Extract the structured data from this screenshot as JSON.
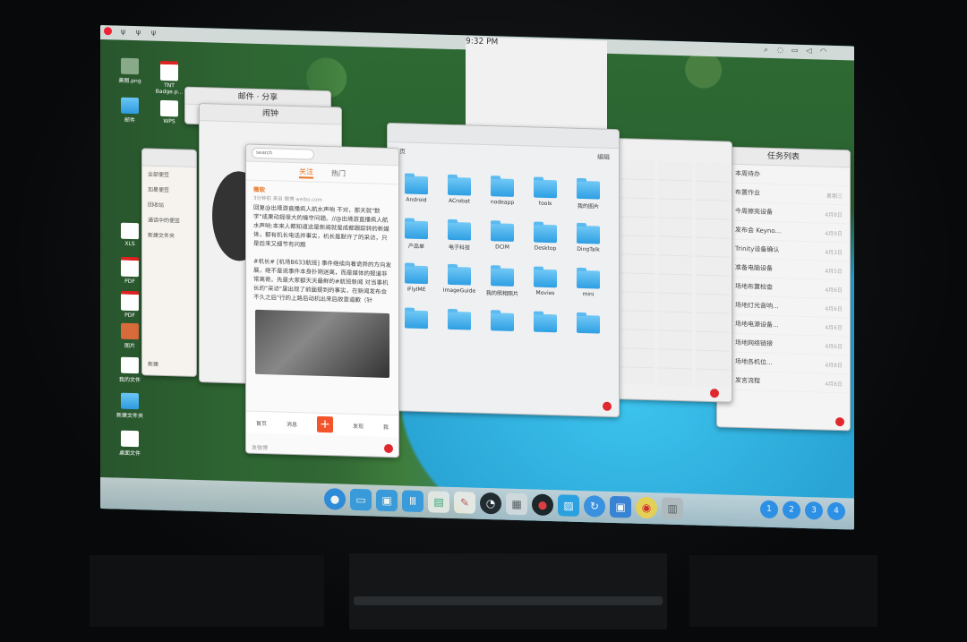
{
  "menubar": {
    "clock": "9:32 PM"
  },
  "clock_window": {
    "title": "闹钟"
  },
  "clock_back_title": {
    "title": "邮件 · 分享"
  },
  "weibo": {
    "search_placeholder": "search",
    "tab_follow": "关注",
    "tab_hot": "热门",
    "post1_user": "微软",
    "post1_meta": "3分钟前 来自 微博 weibo.com",
    "post1_text": "回复@出境游直播疯人航水声响 不对，那天就\"数字\"成果动摇很大的操守问题。//@出境游直播疯人航水声响:本来人都知道这是新闻就是成都跟踪转的新媒体，都有机长电话并事实，机长是默许了的采访，只是后来又细节有问题",
    "post2_text": "#机长# [机场B633航班] 事件继续向着诡异的方向发展，继不是说事件本身扑朔迷离，而是媒体的报道非常离奇。先是大家都天天最鲜的#航班新闻 对当事机长的\"采访\"里出现了前面提到的事实，在新闻发布会不久之后\"行的上路后动机出来后故意道歉（针",
    "nav_home": "首页",
    "nav_msg": "消息",
    "nav_discover": "发现",
    "nav_me": "我",
    "compose": "发微博"
  },
  "files": {
    "path": "主页",
    "right_label": "编辑",
    "items": [
      {
        "name": "Android"
      },
      {
        "name": "ACrobat"
      },
      {
        "name": "nodeapp"
      },
      {
        "name": "tools"
      },
      {
        "name": "我的图片"
      },
      {
        "name": "产品单"
      },
      {
        "name": "电子科技"
      },
      {
        "name": "DCIM"
      },
      {
        "name": "Desktop"
      },
      {
        "name": "DingTalk"
      },
      {
        "name": "iFlyIME"
      },
      {
        "name": "ImageGuide"
      },
      {
        "name": "我的照相照片"
      },
      {
        "name": "Movies"
      },
      {
        "name": "mini"
      },
      {
        "name": ""
      },
      {
        "name": ""
      },
      {
        "name": ""
      },
      {
        "name": ""
      },
      {
        "name": ""
      }
    ]
  },
  "tasklist": {
    "title": "任务列表",
    "items": [
      {
        "label": "本周待办",
        "time": ""
      },
      {
        "label": "布置作业",
        "time": "星期三"
      },
      {
        "label": "今周擦亮设备",
        "time": "4月8日"
      },
      {
        "label": "发布会 Keyno...",
        "time": "4月9日"
      },
      {
        "label": "Trinity设备确认",
        "time": "4月3日"
      },
      {
        "label": "准备电脑设备",
        "time": "4月5日"
      },
      {
        "label": "场地布置检查",
        "time": "4月6日"
      },
      {
        "label": "场地灯光音响...",
        "time": "4月6日"
      },
      {
        "label": "场地电源设备...",
        "time": "4月6日"
      },
      {
        "label": "场地网络链接",
        "time": "4月6日"
      },
      {
        "label": "场地各机位...",
        "time": "4月8日"
      },
      {
        "label": "发言流程",
        "time": "4月8日"
      }
    ]
  },
  "sidebar": {
    "items": [
      "全部便签",
      "加星便签",
      "回收站",
      "通话中的便签",
      "新建文件夹"
    ],
    "footer": "新建"
  },
  "workspaces": [
    "1",
    "2",
    "3",
    "4"
  ],
  "desktop_icons": [
    {
      "name": "美图.png"
    },
    {
      "name": "TNT Badge.p..."
    },
    {
      "name": "邮件"
    },
    {
      "name": "WPS"
    },
    {
      "name": "XLS"
    },
    {
      "name": "PDF"
    },
    {
      "name": "PDF"
    },
    {
      "name": "图片"
    },
    {
      "name": "我的文件"
    },
    {
      "name": "新建文件夹"
    },
    {
      "name": "桌面文件"
    }
  ],
  "colors": {
    "accent": "#e8731e",
    "dock_ws": "#2e8fe6",
    "close": "#e0282e"
  }
}
